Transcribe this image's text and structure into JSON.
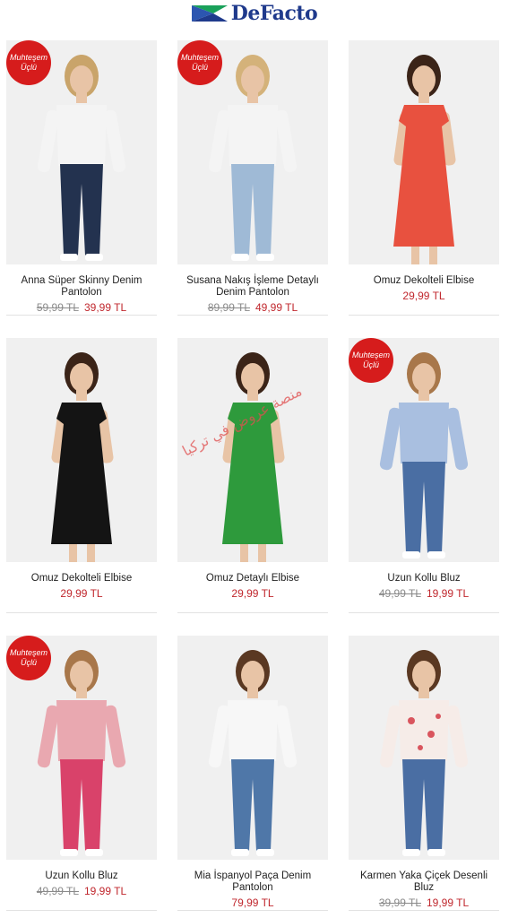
{
  "header": {
    "brand": "DeFacto",
    "brand_colors": {
      "navy": "#1f3a8c",
      "green": "#1aa15a"
    }
  },
  "badge_text": [
    "Muhteşem",
    "Üçlü"
  ],
  "watermark": "منصة عروض في تركيا",
  "products": [
    {
      "name": "Anna Süper Skinny Denim Pantolon",
      "old_price": "59,99 TL",
      "price": "39,99 TL",
      "badge": true,
      "top": "white-tee",
      "bottom": "dark-jeans",
      "hair": "#c9a46a"
    },
    {
      "name": "Susana Nakış İşleme Detaylı Denim Pantolon",
      "old_price": "89,99 TL",
      "price": "49,99 TL",
      "badge": true,
      "top": "white-tee",
      "bottom": "light-jeans",
      "hair": "#d4b27a"
    },
    {
      "name": "Omuz Dekolteli Elbise",
      "old_price": "",
      "price": "29,99 TL",
      "badge": false,
      "top": "red-dress",
      "bottom": "none",
      "hair": "#3b2418"
    },
    {
      "name": "Omuz Dekolteli Elbise",
      "old_price": "",
      "price": "29,99 TL",
      "badge": false,
      "top": "black-dress",
      "bottom": "none",
      "hair": "#3b2418"
    },
    {
      "name": "Omuz Detaylı Elbise",
      "old_price": "",
      "price": "29,99 TL",
      "badge": false,
      "top": "green-dress",
      "bottom": "none",
      "hair": "#3b2418"
    },
    {
      "name": "Uzun Kollu Bluz",
      "old_price": "49,99 TL",
      "price": "19,99 TL",
      "badge": true,
      "top": "blue-blouse",
      "bottom": "jeans",
      "hair": "#a8774a"
    },
    {
      "name": "Uzun Kollu Bluz",
      "old_price": "49,99 TL",
      "price": "19,99 TL",
      "badge": true,
      "top": "pink-blouse",
      "bottom": "gingham",
      "hair": "#a8774a"
    },
    {
      "name": "Mia İspanyol Paça Denim Pantolon",
      "old_price": "",
      "price": "79,99 TL",
      "badge": false,
      "top": "white-offshoulder",
      "bottom": "flare-jeans",
      "hair": "#5a3822"
    },
    {
      "name": "Karmen Yaka Çiçek Desenli Bluz",
      "old_price": "39,99 TL",
      "price": "19,99 TL",
      "badge": false,
      "top": "floral-blouse",
      "bottom": "jeans",
      "hair": "#5a3822"
    }
  ]
}
